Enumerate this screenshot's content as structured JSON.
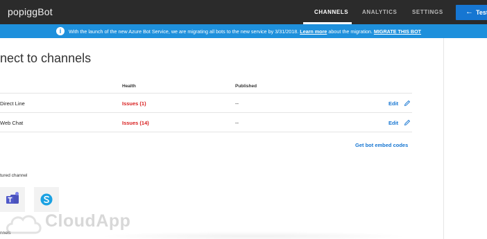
{
  "app": {
    "title": "popiggBot"
  },
  "nav": {
    "tabs": [
      {
        "label": "CHANNELS",
        "active": true
      },
      {
        "label": "ANALYTICS",
        "active": false
      },
      {
        "label": "SETTINGS",
        "active": false
      }
    ],
    "test_button": {
      "label": "Test",
      "icon": "arrow-left-icon"
    }
  },
  "banner": {
    "icon": "info-icon",
    "info_glyph": "i",
    "text": "With the launch of the new Azure Bot Service, we are migrating all bots to the new service by 3/31/2018.",
    "learn_more": "Learn more",
    "after_link": "about the migration.",
    "migrate_link": "MIGRATE THIS BOT",
    "color": "#1e90dc"
  },
  "page": {
    "title": "nect to channels"
  },
  "table": {
    "headers": {
      "health": "Health",
      "published": "Published"
    },
    "rows": [
      {
        "name": "Direct Line",
        "health": "Issues (1)",
        "published": "--",
        "edit": "Edit"
      },
      {
        "name": "Web Chat",
        "health": "Issues (14)",
        "published": "--",
        "edit": "Edit"
      }
    ],
    "embed_link": "Get bot embed codes"
  },
  "featured": {
    "label": "tured channel",
    "channels": [
      {
        "name": "teams",
        "icon": "teams-icon"
      },
      {
        "name": "skype",
        "icon": "skype-icon"
      }
    ]
  },
  "more": {
    "label": "nnels"
  },
  "watermark": {
    "text": "CloudApp"
  },
  "colors": {
    "accent": "#1676d2",
    "error": "#d81e1e",
    "topbar": "#2b2b2b"
  }
}
